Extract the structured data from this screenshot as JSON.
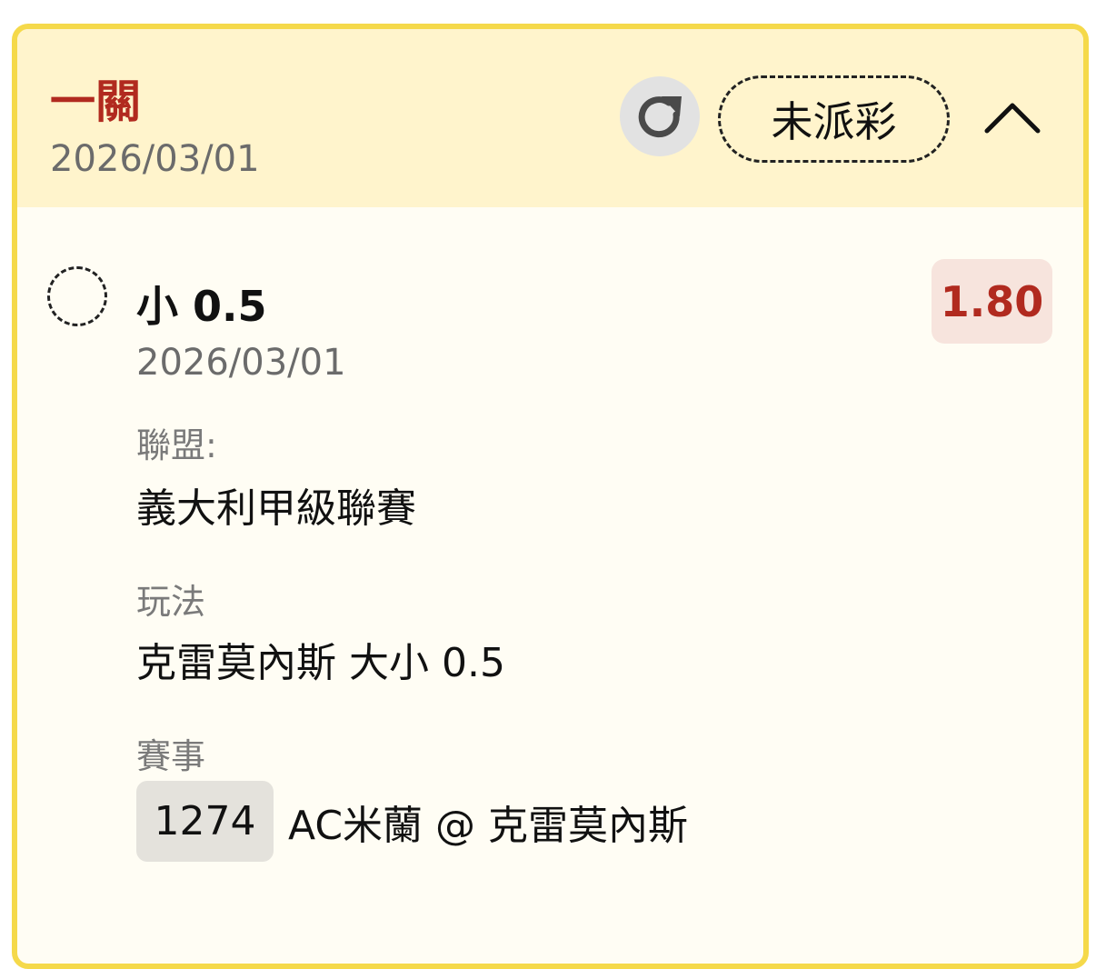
{
  "header": {
    "bet_type": "一關",
    "date": "2026/03/01",
    "status": "未派彩",
    "icons": {
      "refresh": "refresh-icon",
      "collapse": "chevron-up-icon"
    }
  },
  "leg": {
    "selection": "小 0.5",
    "date": "2026/03/01",
    "odds": "1.80",
    "league_label": "聯盟:",
    "league_value": "義大利甲級聯賽",
    "play_label": "玩法",
    "play_value": "克雷莫內斯 大小 0.5",
    "match_label": "賽事",
    "match_code": "1274",
    "match_name": "AC米蘭 @ 克雷莫內斯"
  },
  "colors": {
    "border": "#f5d94a",
    "header_bg": "#fff4cc",
    "body_bg": "#fffdf4",
    "accent_red": "#b12a1f",
    "odds_bg": "#f7e4dd"
  }
}
